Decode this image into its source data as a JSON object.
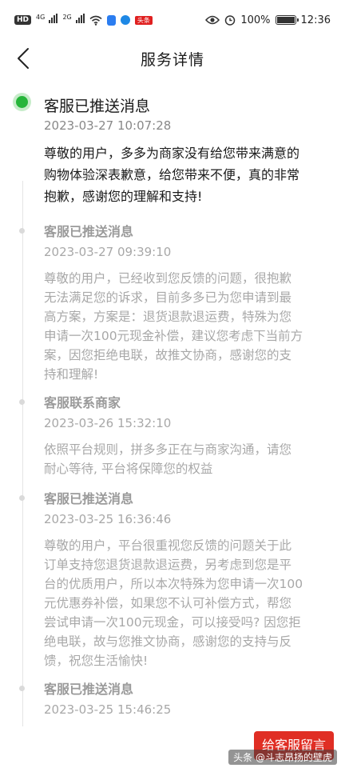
{
  "status_bar": {
    "hd_badge": "HD",
    "signal1": "4G",
    "signal2": "2G",
    "app_tag": "头条",
    "battery_text": "100%",
    "battery_level": 1.0,
    "time": "12:36"
  },
  "header": {
    "title": "服务详情"
  },
  "entries": [
    {
      "title": "客服已推送消息",
      "time": "2023-03-27 10:07:28",
      "body": "尊敬的用户，多多为商家没有给您带来满意的\n购物体验深表歉意，给您带来不便，真的非常\n抱歉，感谢您的理解和支持!",
      "active": true
    },
    {
      "title": "客服已推送消息",
      "time": "2023-03-27 09:39:10",
      "body": "尊敬的用户，已经收到您反馈的问题，很抱歉\n无法满足您的诉求，目前多多已为您申请到最\n高方案，方案是：退货退款退运费，特殊为您\n申请一次100元现金补偿，建议您考虑下当前方\n案，因您拒绝电联，故推文协商，感谢您的支\n持和理解!",
      "active": false
    },
    {
      "title": "客服联系商家",
      "time": "2023-03-26 15:32:10",
      "body": "依照平台规则，拼多多正在与商家沟通，请您\n耐心等待, 平台将保障您的权益",
      "active": false
    },
    {
      "title": "客服已推送消息",
      "time": "2023-03-25 16:36:46",
      "body": "尊敬的用户，平台很重视您反馈的问题关于此\n订单支持您退货退款退运费，另考虑到您是平\n台的优质用户，所以本次特殊为您申请一次100\n元优惠券补偿，如果您不认可补偿方式，帮您\n尝试申请一次100元现金，可以接受吗? 因您拒\n绝电联，故与您推文协商，感谢您的支持与反\n馈，祝您生活愉快!",
      "active": false
    },
    {
      "title": "客服已推送消息",
      "time": "2023-03-25 15:46:25",
      "body": "",
      "active": false
    }
  ],
  "footer": {
    "cta_label": "给客服留言",
    "watermark": "头条 @斗志昂扬的壁虎"
  },
  "colors": {
    "accent_green": "#26b53a",
    "cta_red": "#e02e24",
    "text_primary": "#1a1a1a",
    "text_muted": "#a8a8a8"
  }
}
